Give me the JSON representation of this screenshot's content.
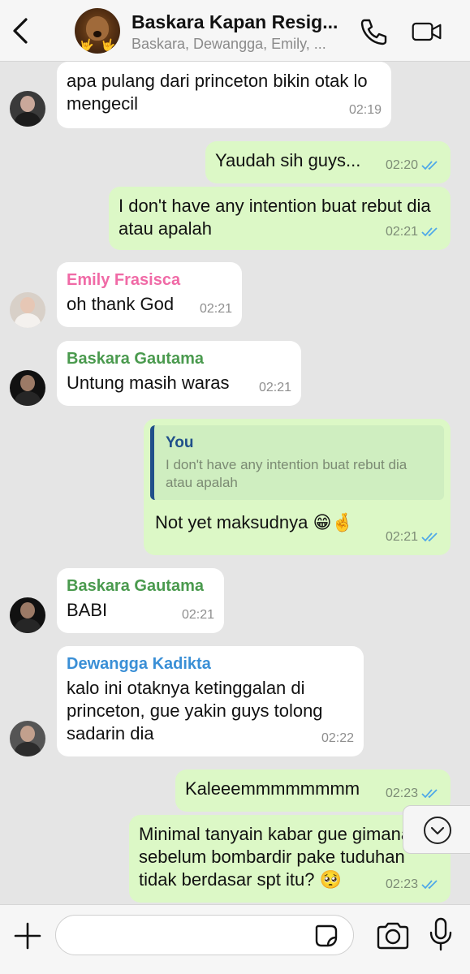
{
  "header": {
    "title": "Baskara Kapan Resig...",
    "subtitle": "Baskara, Dewangga, Emily, ...",
    "avatar_emojis": [
      "🤟",
      "🤟"
    ],
    "icons": [
      "back-icon",
      "phone-icon",
      "video-call-icon"
    ]
  },
  "messages": [
    {
      "dir": "in",
      "sender": "",
      "text": "apa pulang dari princeton bikin otak lo mengecil",
      "time": "02:19"
    },
    {
      "dir": "out",
      "text": "Yaudah sih guys...",
      "time": "02:20",
      "read": true
    },
    {
      "dir": "out",
      "text": "I don't have any intention buat rebut dia atau apalah",
      "time": "02:21",
      "read": true
    },
    {
      "dir": "in",
      "sender": "Emily Frasisca",
      "text": "oh thank God",
      "time": "02:21"
    },
    {
      "dir": "in",
      "sender": "Baskara Gautama",
      "text": "Untung masih waras",
      "time": "02:21"
    },
    {
      "dir": "out",
      "reply_to": {
        "author": "You",
        "text": "I don't have any intention buat rebut dia atau apalah"
      },
      "text": "Not yet maksudnya",
      "emoji": "😁🤞",
      "time": "02:21",
      "read": true
    },
    {
      "dir": "in",
      "sender": "Baskara Gautama",
      "text": "BABI",
      "time": "02:21"
    },
    {
      "dir": "in",
      "sender": "Dewangga Kadikta",
      "text": "kalo ini otaknya ketinggalan di princeton, gue yakin guys tolong sadarin dia",
      "time": "02:22"
    },
    {
      "dir": "out",
      "text": "Kaleeemmmmmmmm",
      "time": "02:23",
      "read": true
    },
    {
      "dir": "out",
      "text": "Minimal tanyain kabar gue gimana sebelum bombardir pake tuduhan tidak berdasar spt itu?",
      "emoji": "🥺",
      "time": "02:23",
      "read": true
    }
  ],
  "composer": {
    "placeholder": "",
    "icons": [
      "plus-icon",
      "sticker-icon",
      "camera-icon",
      "microphone-icon"
    ]
  },
  "scroll_button": {
    "icon": "chevron-down-icon"
  },
  "colors": {
    "outgoing_bubble": "#dcf8c6",
    "incoming_bubble": "#ffffff",
    "chat_background": "#e5e5e5",
    "read_ticks": "#4fa8e8",
    "sender_emily": "#f06aa6",
    "sender_baskara": "#4a9a4e",
    "sender_dewangga": "#3a8fd6",
    "reply_author": "#20508a"
  }
}
